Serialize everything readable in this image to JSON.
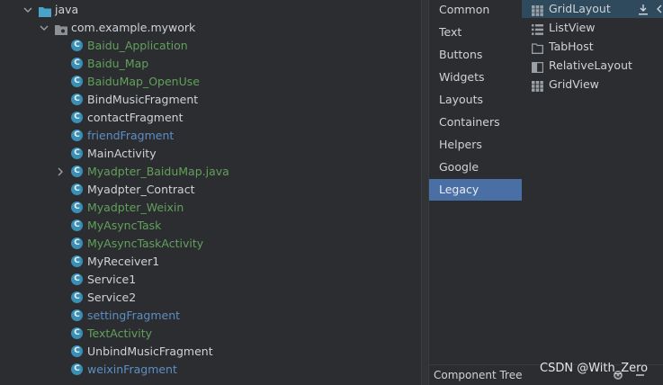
{
  "project_tree": {
    "java_folder": "java",
    "package": "com.example.mywork",
    "items": [
      {
        "label": "Baidu_Application",
        "color": "#62a05c"
      },
      {
        "label": "Baidu_Map",
        "color": "#62a05c"
      },
      {
        "label": "BaiduMap_OpenUse",
        "color": "#62a05c"
      },
      {
        "label": "BindMusicFragment",
        "color": "#cfd2d6"
      },
      {
        "label": "contactFragment",
        "color": "#cfd2d6"
      },
      {
        "label": "friendFragment",
        "color": "#5d8fc4"
      },
      {
        "label": "MainActivity",
        "color": "#cfd2d6"
      },
      {
        "label": "Myadpter_BaiduMap.java",
        "color": "#62a05c"
      },
      {
        "label": "Myadpter_Contract",
        "color": "#cfd2d6"
      },
      {
        "label": "Myadpter_Weixin",
        "color": "#62a05c"
      },
      {
        "label": "MyAsyncTask",
        "color": "#62a05c"
      },
      {
        "label": "MyAsyncTaskActivity",
        "color": "#62a05c"
      },
      {
        "label": "MyReceiver1",
        "color": "#cfd2d6"
      },
      {
        "label": "Service1",
        "color": "#cfd2d6"
      },
      {
        "label": "Service2",
        "color": "#cfd2d6"
      },
      {
        "label": "settingFragment",
        "color": "#5d8fc4"
      },
      {
        "label": "TextActivity",
        "color": "#62a05c"
      },
      {
        "label": "UnbindMusicFragment",
        "color": "#cfd2d6"
      },
      {
        "label": "weixinFragment",
        "color": "#5d8fc4"
      }
    ],
    "class_icon_letter": "C"
  },
  "palette": {
    "categories": [
      "Common",
      "Text",
      "Buttons",
      "Widgets",
      "Layouts",
      "Containers",
      "Helpers",
      "Google",
      "Legacy"
    ],
    "selected_category": "Legacy",
    "items": [
      "GridLayout",
      "ListView",
      "TabHost",
      "RelativeLayout",
      "GridView"
    ],
    "selected_item": "GridLayout"
  },
  "bottom": {
    "component_tree_label": "Component Tree",
    "watermark": "CSDN @With_Zero"
  }
}
